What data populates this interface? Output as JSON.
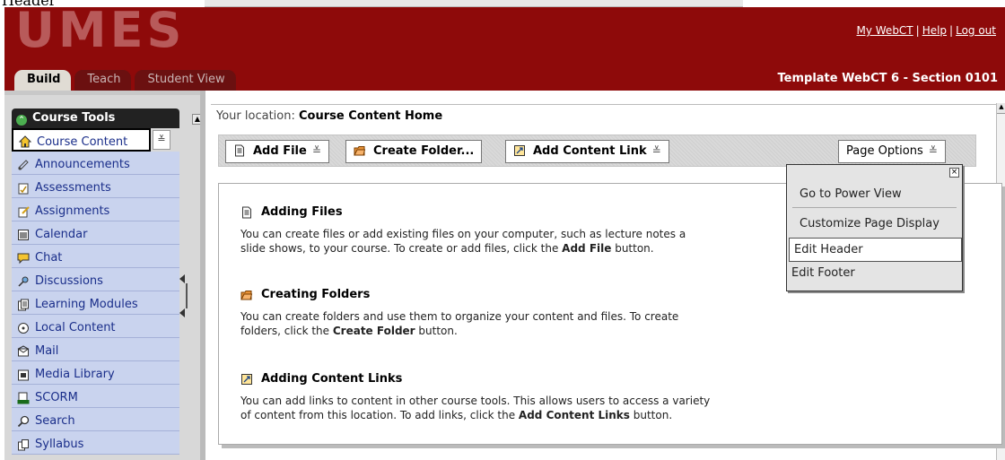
{
  "caption": "Header",
  "header": {
    "logo": "UMES",
    "links": [
      "My WebCT",
      "Help",
      "Log out"
    ],
    "link_separator": "|",
    "tabs": [
      {
        "label": "Build",
        "active": true
      },
      {
        "label": "Teach",
        "active": false
      },
      {
        "label": "Student View",
        "active": false
      }
    ],
    "section_title": "Template WebCT 6 - Section 0101",
    "colors": {
      "brand": "#8e0a0a",
      "tool_item_bg": "#c9d3ee"
    }
  },
  "sidebar": {
    "title": "Course Tools",
    "items": [
      {
        "label": "Course Content",
        "icon": "home-icon"
      },
      {
        "label": "Announcements",
        "icon": "megaphone-icon"
      },
      {
        "label": "Assessments",
        "icon": "assessment-icon"
      },
      {
        "label": "Assignments",
        "icon": "assignment-icon"
      },
      {
        "label": "Calendar",
        "icon": "calendar-icon"
      },
      {
        "label": "Chat",
        "icon": "chat-bubble-icon"
      },
      {
        "label": "Discussions",
        "icon": "discussion-pin-icon"
      },
      {
        "label": "Learning Modules",
        "icon": "modules-icon"
      },
      {
        "label": "Local Content",
        "icon": "local-content-icon"
      },
      {
        "label": "Mail",
        "icon": "mail-icon"
      },
      {
        "label": "Media Library",
        "icon": "media-library-icon"
      },
      {
        "label": "SCORM",
        "icon": "scorm-icon"
      },
      {
        "label": "Search",
        "icon": "search-icon"
      },
      {
        "label": "Syllabus",
        "icon": "syllabus-icon"
      }
    ]
  },
  "main": {
    "location_label": "Your location:",
    "location_value": "Course Content Home",
    "buttons": {
      "add_file": "Add File",
      "create_folder": "Create Folder...",
      "add_content_link": "Add Content Link",
      "page_options": "Page Options"
    },
    "dropdown_glyph": "≚",
    "sections": [
      {
        "title": "Adding Files",
        "icon": "file-icon",
        "text_before": "You can create files or add existing files on your computer, such as lecture notes a",
        "text_line2_before": "slide shows, to your course. To create or add files, click the ",
        "bold": "Add File",
        "text_after": " button."
      },
      {
        "title": "Creating Folders",
        "icon": "folder-icon",
        "text_before": "You can create folders and use them to organize your content and files. To create",
        "text_line2_before": "folders, click the ",
        "bold": "Create Folder",
        "text_after": " button."
      },
      {
        "title": "Adding Content Links",
        "icon": "content-link-icon",
        "text_before": "You can add links to content in other course tools. This allows users to access a variety",
        "text_line2_before": "of content from this location. To add links, click the ",
        "bold": "Add Content Links",
        "text_after": " button."
      }
    ]
  },
  "page_options_menu": {
    "close_glyph": "×",
    "items": [
      "Go to Power View",
      "Customize Page Display",
      "Edit Header",
      "Edit Footer"
    ],
    "hovered": "Edit Header"
  }
}
